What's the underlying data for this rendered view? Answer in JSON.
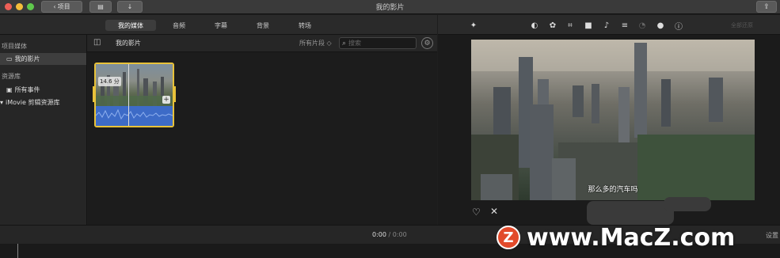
{
  "window": {
    "title": "我的影片",
    "back_label": "项目"
  },
  "tabs": [
    {
      "label": "我的媒体",
      "active": true
    },
    {
      "label": "音频",
      "active": false
    },
    {
      "label": "字幕",
      "active": false
    },
    {
      "label": "背景",
      "active": false
    },
    {
      "label": "转场",
      "active": false
    }
  ],
  "sidebar": {
    "projects_heading": "项目媒体",
    "my_movie": "我的影片",
    "library_heading": "资源库",
    "all_events": "所有事件",
    "library_name": "iMovie 剪辑资源库"
  },
  "browser": {
    "title": "我的影片",
    "filter": "所有片段 ◇",
    "search_placeholder": "搜索",
    "clip": {
      "duration": "14.6 分"
    }
  },
  "viewer": {
    "toolbar_hint": "全部还原",
    "subtitle": "那么多的汽车吗"
  },
  "timeline": {
    "current_time": "0:00",
    "separator": "/",
    "total_time": "0:00",
    "settings_label": "设置"
  },
  "watermark": {
    "logo": "Z",
    "text": "www.MacZ.com"
  },
  "colors": {
    "accent_yellow": "#e8c23a",
    "audio_blue": "#3d6bc7",
    "watermark_red": "#e24a2b"
  }
}
